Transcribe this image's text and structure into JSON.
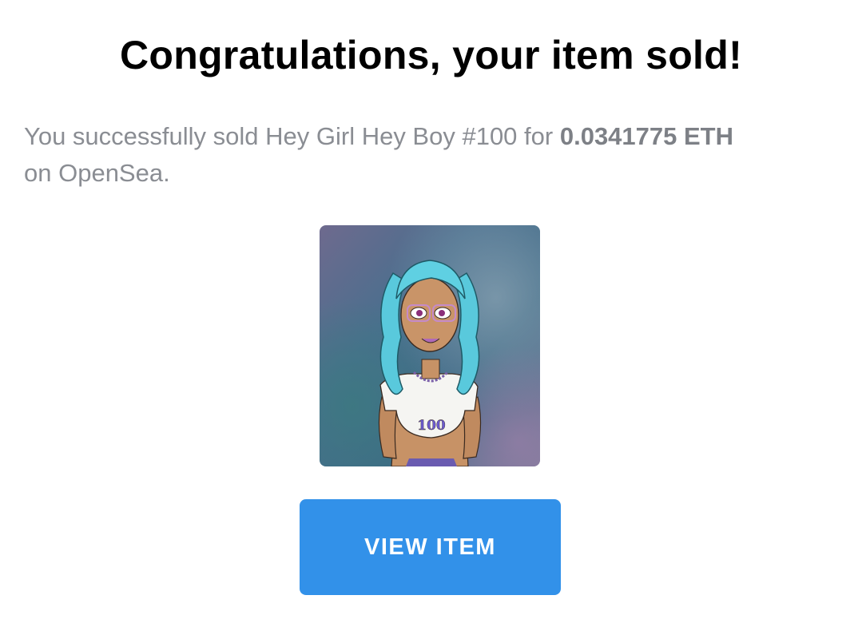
{
  "email": {
    "title": "Congratulations, your item sold!",
    "message_prefix": "You successfully sold Hey Girl Hey Boy #100 for",
    "price": "0.0341775 ETH",
    "message_suffix": "on OpenSea.",
    "nft_shirt_number": "100",
    "button_label": "VIEW ITEM"
  },
  "colors": {
    "button_background": "#3291e9",
    "title_text": "#000000",
    "body_text": "#8a8d93"
  },
  "icons": {
    "nft_image": "nft-illustration-girl-blue-braids"
  }
}
